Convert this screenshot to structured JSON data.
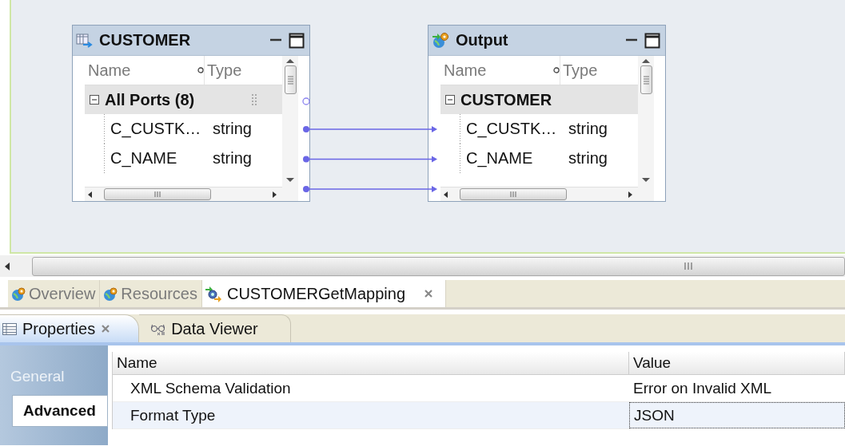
{
  "diagram": {
    "nodes": [
      {
        "title": "CUSTOMER",
        "kind": "source",
        "columns": [
          "Name",
          "Type"
        ],
        "group": {
          "label": "All Ports (8)",
          "expanded": true
        },
        "ports": [
          {
            "name": "C_CUSTK…",
            "type": "string"
          },
          {
            "name": "C_NAME",
            "type": "string"
          }
        ]
      },
      {
        "title": "Output",
        "kind": "output",
        "columns": [
          "Name",
          "Type"
        ],
        "group": {
          "label": "CUSTOMER",
          "expanded": true
        },
        "ports": [
          {
            "name": "C_CUSTK…",
            "type": "string"
          },
          {
            "name": "C_NAME",
            "type": "string"
          }
        ]
      }
    ],
    "links": [
      {
        "kind": "mapped"
      },
      {
        "kind": "mapped"
      },
      {
        "kind": "mapped"
      }
    ]
  },
  "editor_tabs": [
    {
      "label": "Overview",
      "kind": "globe",
      "selected": false,
      "closable": false
    },
    {
      "label": "Resources",
      "kind": "globe",
      "selected": false,
      "closable": false
    },
    {
      "label": "CUSTOMERGetMapping",
      "kind": "mapping",
      "selected": true,
      "closable": true
    }
  ],
  "view_tabs": [
    {
      "label": "Properties",
      "kind": "table",
      "selected": true,
      "closable": true
    },
    {
      "label": "Data Viewer",
      "kind": "glasses",
      "selected": false,
      "closable": false
    }
  ],
  "properties": {
    "sections": [
      {
        "label": "General",
        "selected": false
      },
      {
        "label": "Advanced",
        "selected": true
      }
    ],
    "columns": [
      "Name",
      "Value"
    ],
    "rows": [
      {
        "name": "XML Schema Validation",
        "value": "Error on Invalid XML",
        "selected": false
      },
      {
        "name": "Format Type",
        "value": "JSON",
        "selected": true
      }
    ]
  }
}
